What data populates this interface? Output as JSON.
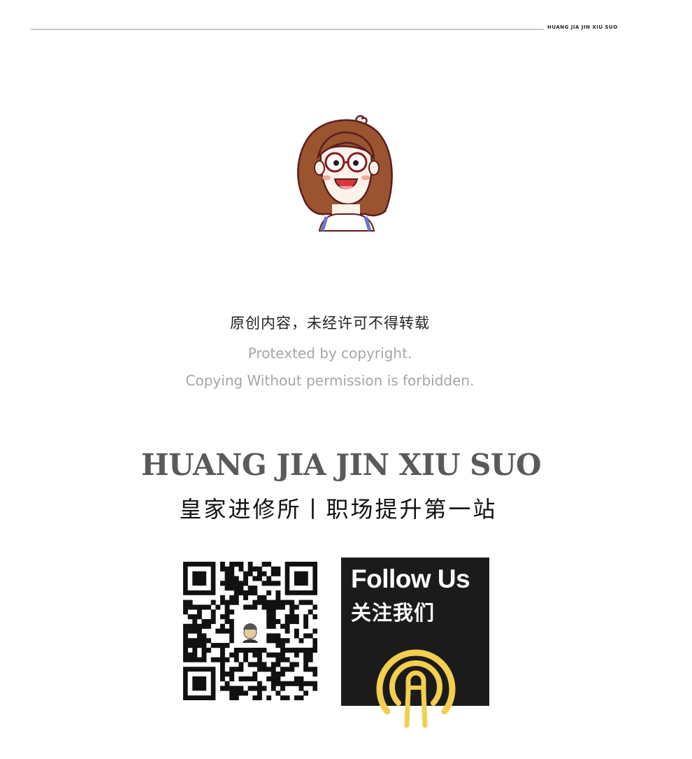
{
  "header": {
    "tag": "HUANG JIA JIN XIU SUO"
  },
  "avatar": {
    "icon": "cartoon-girl-with-glasses-icon"
  },
  "notice": {
    "cn": "原创内容，未经许可不得转载",
    "en_line1": "Protexted by copyright.",
    "en_line2": "Copying Without permission is forbidden."
  },
  "brand": {
    "title": "HUANG JIA JIN XIU SUO",
    "subtitle": "皇家进修所丨职场提升第一站"
  },
  "qr": {
    "icon": "wechat-qr-code-icon"
  },
  "follow": {
    "en": "Follow Us",
    "cn": "关注我们",
    "icon": "podcast-icon"
  },
  "colors": {
    "brand_gray": "#5a5a5a",
    "caption_gray": "#a6a6a6",
    "follow_bg": "#1c1b1b",
    "accent_yellow": "#f3cf4f"
  }
}
